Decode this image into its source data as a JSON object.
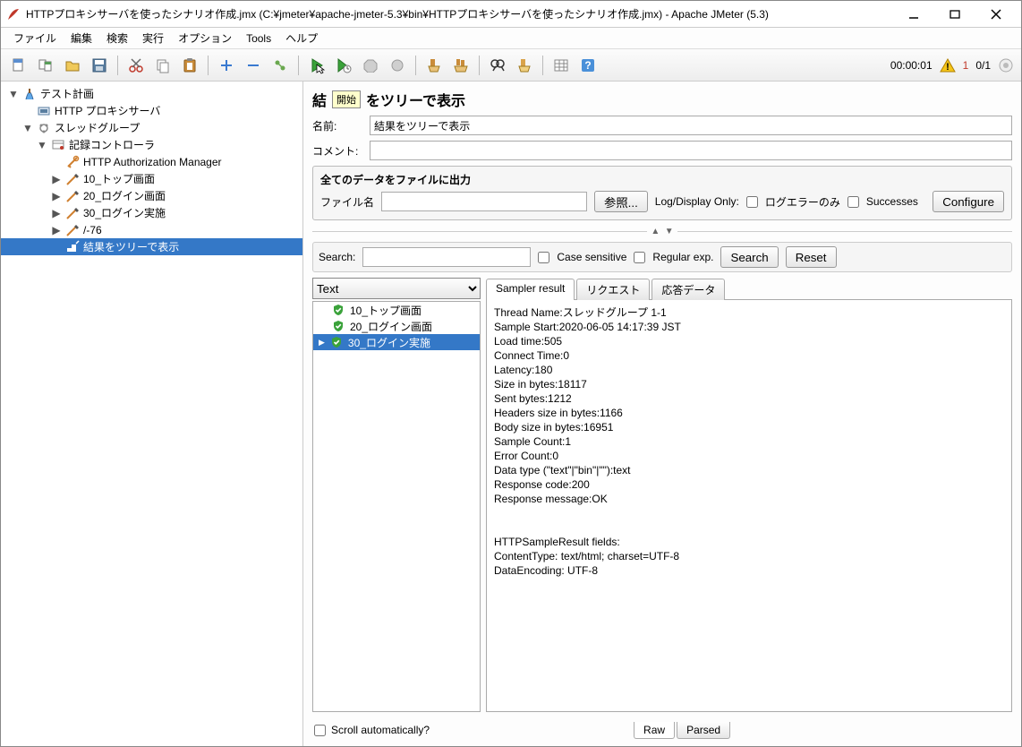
{
  "window": {
    "title": "HTTPプロキシサーバを使ったシナリオ作成.jmx (C:¥jmeter¥apache-jmeter-5.3¥bin¥HTTPプロキシサーバを使ったシナリオ作成.jmx) - Apache JMeter (5.3)"
  },
  "menu": {
    "file": "ファイル",
    "edit": "編集",
    "search": "検索",
    "run": "実行",
    "options": "オプション",
    "tools": "Tools",
    "help": "ヘルプ"
  },
  "toolbar": {
    "tooltip_start": "開始"
  },
  "status": {
    "timer": "00:00:01",
    "errorcount": "1",
    "threads": "0/1"
  },
  "tree": {
    "items": [
      {
        "depth": 0,
        "expand": "▼",
        "icon": "testplan",
        "label": "テスト計画"
      },
      {
        "depth": 1,
        "expand": "",
        "icon": "httpproxy",
        "label": "HTTP プロキシサーバ"
      },
      {
        "depth": 1,
        "expand": "▼",
        "icon": "threadgroup",
        "label": "スレッドグループ"
      },
      {
        "depth": 2,
        "expand": "▼",
        "icon": "recordctrl",
        "label": "記録コントローラ"
      },
      {
        "depth": 3,
        "expand": "",
        "icon": "authmgr",
        "label": "HTTP Authorization Manager"
      },
      {
        "depth": 3,
        "expand": "▶",
        "icon": "sampler",
        "label": "10_トップ画面"
      },
      {
        "depth": 3,
        "expand": "▶",
        "icon": "sampler",
        "label": "20_ログイン画面"
      },
      {
        "depth": 3,
        "expand": "▶",
        "icon": "sampler",
        "label": "30_ログイン実施"
      },
      {
        "depth": 3,
        "expand": "▶",
        "icon": "sampler",
        "label": "/-76"
      },
      {
        "depth": 3,
        "expand": "",
        "icon": "resultstree",
        "label": "結果をツリーで表示",
        "selected": true
      }
    ]
  },
  "panel": {
    "title_prefix": "結",
    "title_suffix": "をツリーで表示",
    "name_label": "名前:",
    "name_value": "結果をツリーで表示",
    "comment_label": "コメント:",
    "comment_value": "",
    "output_group_title": "全てのデータをファイルに出力",
    "filename_label": "ファイル名",
    "filename_value": "",
    "browse_btn": "参照...",
    "logdisplay_label": "Log/Display Only:",
    "log_errors_only": "ログエラーのみ",
    "successes": "Successes",
    "configure_btn": "Configure"
  },
  "searchrow": {
    "label": "Search:",
    "value": "",
    "case_sensitive": "Case sensitive",
    "regex": "Regular exp.",
    "search_btn": "Search",
    "reset_btn": "Reset"
  },
  "results": {
    "renderer_selected": "Text",
    "items": [
      {
        "label": "10_トップ画面",
        "selected": false
      },
      {
        "label": "20_ログイン画面",
        "selected": false
      },
      {
        "label": "30_ログイン実施",
        "selected": true
      }
    ],
    "tabs": {
      "sampler": "Sampler result",
      "request": "リクエスト",
      "response": "応答データ"
    },
    "sampler_text": "Thread Name:スレッドグループ 1-1\nSample Start:2020-06-05 14:17:39 JST\nLoad time:505\nConnect Time:0\nLatency:180\nSize in bytes:18117\nSent bytes:1212\nHeaders size in bytes:1166\nBody size in bytes:16951\nSample Count:1\nError Count:0\nData type (\"text\"|\"bin\"|\"\"):text\nResponse code:200\nResponse message:OK\n\n\nHTTPSampleResult fields:\nContentType: text/html; charset=UTF-8\nDataEncoding: UTF-8",
    "bottom_tabs": {
      "raw": "Raw",
      "parsed": "Parsed"
    },
    "scroll_auto": "Scroll automatically?"
  }
}
